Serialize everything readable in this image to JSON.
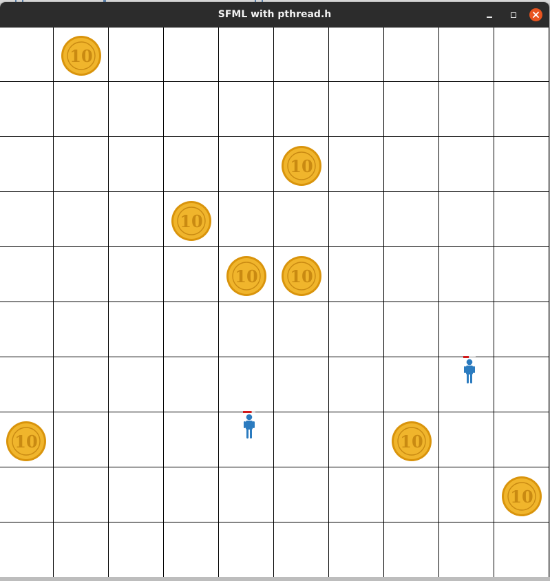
{
  "window": {
    "title": "SFML with pthread.h",
    "controls": [
      "minimize-icon",
      "maximize-icon",
      "close-icon"
    ],
    "close_color": "#e9541f",
    "titlebar_color": "#2c2c2c"
  },
  "board": {
    "rows": 10,
    "cols": 10,
    "grid_line_color": "#000000",
    "background": "#ffffff",
    "coins": [
      {
        "row": 0,
        "col": 1,
        "value": "10"
      },
      {
        "row": 2,
        "col": 5,
        "value": "10"
      },
      {
        "row": 3,
        "col": 3,
        "value": "10"
      },
      {
        "row": 4,
        "col": 4,
        "value": "10"
      },
      {
        "row": 4,
        "col": 5,
        "value": "10"
      },
      {
        "row": 7,
        "col": 0,
        "value": "10"
      },
      {
        "row": 7,
        "col": 7,
        "value": "10"
      },
      {
        "row": 8,
        "col": 9,
        "value": "10"
      }
    ],
    "players": [
      {
        "id": "player-1",
        "row": 6,
        "col": 8,
        "color": "#2b7bbf",
        "health_bar": 0.45
      },
      {
        "id": "player-2",
        "row": 7,
        "col": 4,
        "color": "#2b7bbf",
        "health_bar": 0.7
      }
    ]
  }
}
